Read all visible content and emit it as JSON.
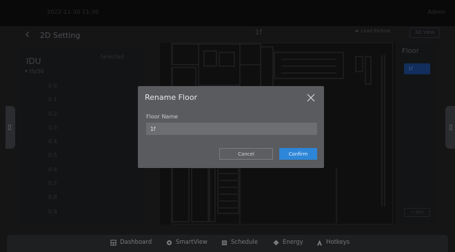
{
  "statusbar": {
    "datetime": "2022-11-30 11:30",
    "user": "Admin"
  },
  "header": {
    "back_icon": "chevron-left-icon",
    "title": "2D Setting",
    "floor_name": "1f",
    "load_picture_label": "Load Picture",
    "view_3d_label": "3D View"
  },
  "idu_panel": {
    "title": "IDU",
    "selected_label": "Selected",
    "group_label": "tty50",
    "items": [
      "0.0",
      "0.1",
      "0.2",
      "0.3",
      "0.4",
      "0.5",
      "0.6",
      "0.7",
      "0.8",
      "0.9"
    ]
  },
  "floor_panel": {
    "title": "Floor",
    "floors": [
      "1f"
    ],
    "add_label": "+ Add"
  },
  "dialog": {
    "title": "Rename Floor",
    "field_label": "Floor Name",
    "field_value": "1f",
    "cancel_label": "Cancel",
    "confirm_label": "Confirm"
  },
  "bottom_nav": {
    "items": [
      {
        "label": "Dashboard",
        "icon": "dashboard-icon"
      },
      {
        "label": "SmartView",
        "icon": "smartview-icon"
      },
      {
        "label": "Schedule",
        "icon": "schedule-icon"
      },
      {
        "label": "Energy",
        "icon": "energy-icon"
      },
      {
        "label": "Hotkeys",
        "icon": "hotkeys-icon"
      }
    ]
  },
  "colors": {
    "accent": "#2d86d8",
    "selected_floor": "#1a4080",
    "dialog_bg": "#5a5b5e"
  }
}
